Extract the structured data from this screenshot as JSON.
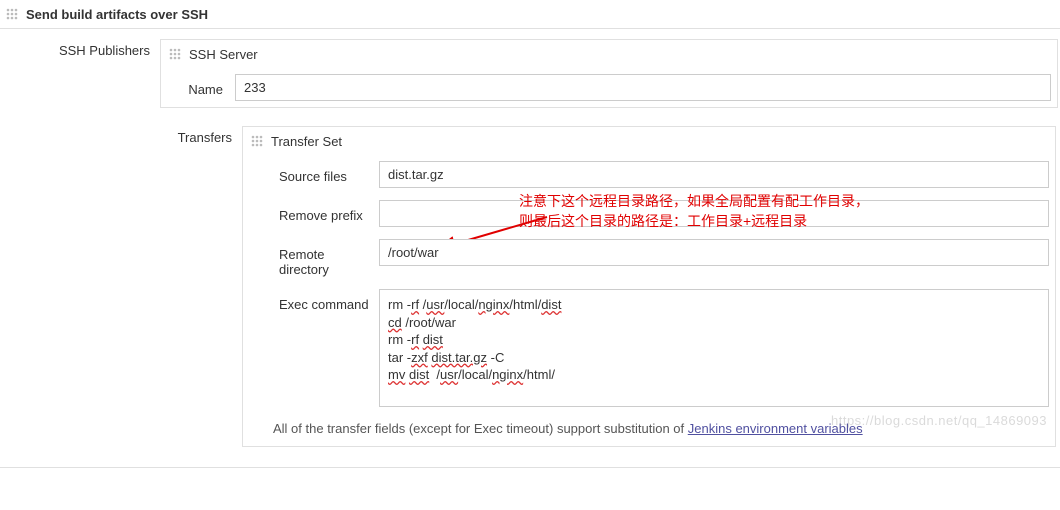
{
  "section": {
    "title": "Send build artifacts over SSH"
  },
  "publishers": {
    "label": "SSH Publishers",
    "server": {
      "header": "SSH Server",
      "name_label": "Name",
      "name_value": "233"
    },
    "transfers": {
      "label": "Transfers",
      "set_header": "Transfer Set",
      "source_label": "Source files",
      "source_value": "dist.tar.gz",
      "remove_prefix_label": "Remove prefix",
      "remove_prefix_value": "",
      "remote_dir_label": "Remote directory",
      "remote_dir_value": "/root/war",
      "exec_label": "Exec command",
      "exec_value": "rm -rf /usr/local/nginx/html/dist\ncd /root/war\nrm -rf dist\ntar -zxf dist.tar.gz -C\nmv dist  /usr/local/nginx/html/",
      "help_prefix": "All of the transfer fields (except for Exec timeout) support substitution of ",
      "help_link": "Jenkins environment variables"
    }
  },
  "annotation": {
    "line1": "注意下这个远程目录路径，如果全局配置有配工作目录，",
    "line2": "则最后这个目录的路径是：工作目录+远程目录"
  },
  "watermark": "https://blog.csdn.net/qq_14869093"
}
